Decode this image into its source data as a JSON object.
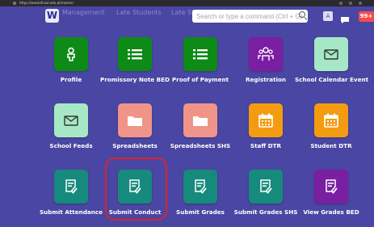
{
  "browser": {
    "url": "https://weeksfcool.edu.ph/rooms/"
  },
  "header": {
    "logo": "W",
    "nav": [
      "Management",
      "Late Students",
      "Late St"
    ],
    "search_placeholder": "Search or type a command (Ctrl + G)",
    "lang_label": "A",
    "notification_count": "99+"
  },
  "tiles": [
    {
      "label": "Profile",
      "color": "#0e8a16",
      "icon": "person-icon"
    },
    {
      "label": "Promissory Note BED",
      "color": "#0e8a16",
      "icon": "list-icon"
    },
    {
      "label": "Proof of Payment",
      "color": "#0e8a16",
      "icon": "list-icon"
    },
    {
      "label": "Registration",
      "color": "#7b1fa2",
      "icon": "group-icon"
    },
    {
      "label": "School Calendar Event",
      "color": "#a6e8c6",
      "icon": "mail-icon"
    },
    {
      "label": "School Feeds",
      "color": "#a6e8c6",
      "icon": "mail-icon"
    },
    {
      "label": "Spreadsheets",
      "color": "#f0948a",
      "icon": "folder-icon"
    },
    {
      "label": "Spreadsheets SHS",
      "color": "#f0948a",
      "icon": "folder-icon"
    },
    {
      "label": "Staff DTR",
      "color": "#f39c12",
      "icon": "calendar-icon"
    },
    {
      "label": "Student DTR",
      "color": "#f39c12",
      "icon": "calendar-icon"
    },
    {
      "label": "Submit Attendance",
      "color": "#168a7d",
      "icon": "checklist-icon"
    },
    {
      "label": "Submit Conduct",
      "color": "#168a7d",
      "icon": "checklist-icon"
    },
    {
      "label": "Submit Grades",
      "color": "#168a7d",
      "icon": "checklist-icon"
    },
    {
      "label": "Submit Grades SHS",
      "color": "#168a7d",
      "icon": "checklist-icon"
    },
    {
      "label": "View Grades BED",
      "color": "#7b1fa2",
      "icon": "checklist-icon"
    }
  ],
  "highlight_color": "#d9232e"
}
